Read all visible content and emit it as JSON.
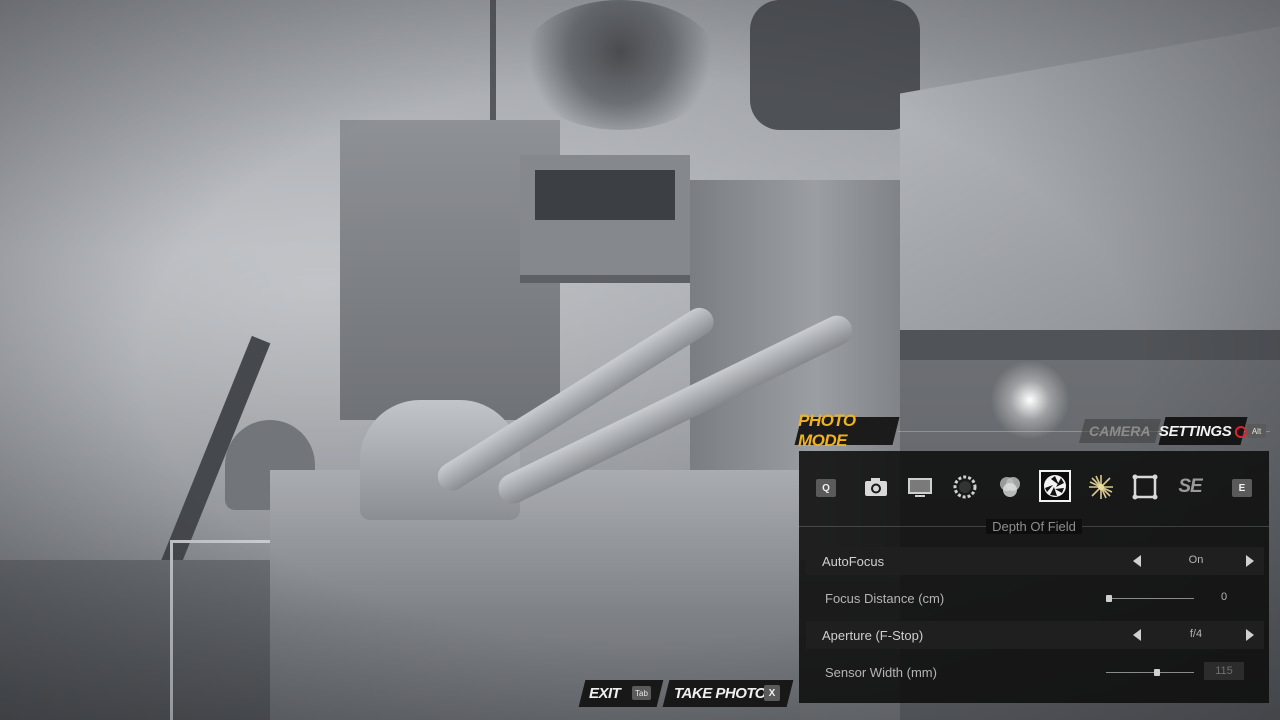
{
  "header": {
    "mode_title": "PHOTO MODE",
    "tabs": [
      {
        "label": "CAMERA",
        "active": false
      },
      {
        "label": "SETTINGS",
        "active": true
      }
    ],
    "tab_switch_key": "Alt"
  },
  "panel": {
    "prev_key": "Q",
    "next_key": "E",
    "icons": [
      {
        "name": "camera-icon"
      },
      {
        "name": "monitor-icon"
      },
      {
        "name": "vignette-ring-icon"
      },
      {
        "name": "color-blend-icon"
      },
      {
        "name": "aperture-icon",
        "selected": true
      },
      {
        "name": "sunburst-icon"
      },
      {
        "name": "frame-border-icon"
      },
      {
        "name": "logo-se-icon",
        "text": "SE"
      }
    ],
    "section_title": "Depth Of Field",
    "settings": [
      {
        "label": "AutoFocus",
        "type": "option",
        "value": "On"
      },
      {
        "label": "Focus Distance (cm)",
        "type": "slider",
        "value": "0",
        "position": 0.0
      },
      {
        "label": "Aperture (F-Stop)",
        "type": "option",
        "value": "f/4"
      },
      {
        "label": "Sensor Width (mm)",
        "type": "slider",
        "value": "115",
        "position": 0.58
      }
    ]
  },
  "bottom_bar": {
    "exit_label": "EXIT",
    "exit_key": "Tab",
    "take_photo_label": "TAKE PHOTO",
    "take_photo_key": "X"
  },
  "colors": {
    "accent": "#f0b21f",
    "record": "#e0202a",
    "panel_bg": "#0e0e0e"
  }
}
